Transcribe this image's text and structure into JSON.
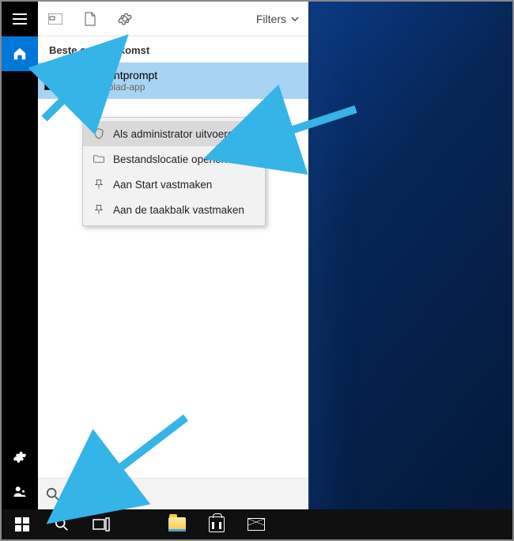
{
  "topbar": {
    "filters_label": "Filters"
  },
  "section_label": "Beste overeenkomst",
  "best_match": {
    "title": "Opdrachtprompt",
    "subtitle": "Bureaublad-app"
  },
  "context_menu": {
    "items": [
      {
        "label": "Als administrator uitvoeren",
        "icon": "shield"
      },
      {
        "label": "Bestandslocatie openen",
        "icon": "folder-open"
      },
      {
        "label": "Aan Start vastmaken",
        "icon": "pin"
      },
      {
        "label": "Aan de taakbalk vastmaken",
        "icon": "pin"
      }
    ]
  },
  "search": {
    "value": "cmd"
  },
  "arrow_color": "#35b4e8"
}
